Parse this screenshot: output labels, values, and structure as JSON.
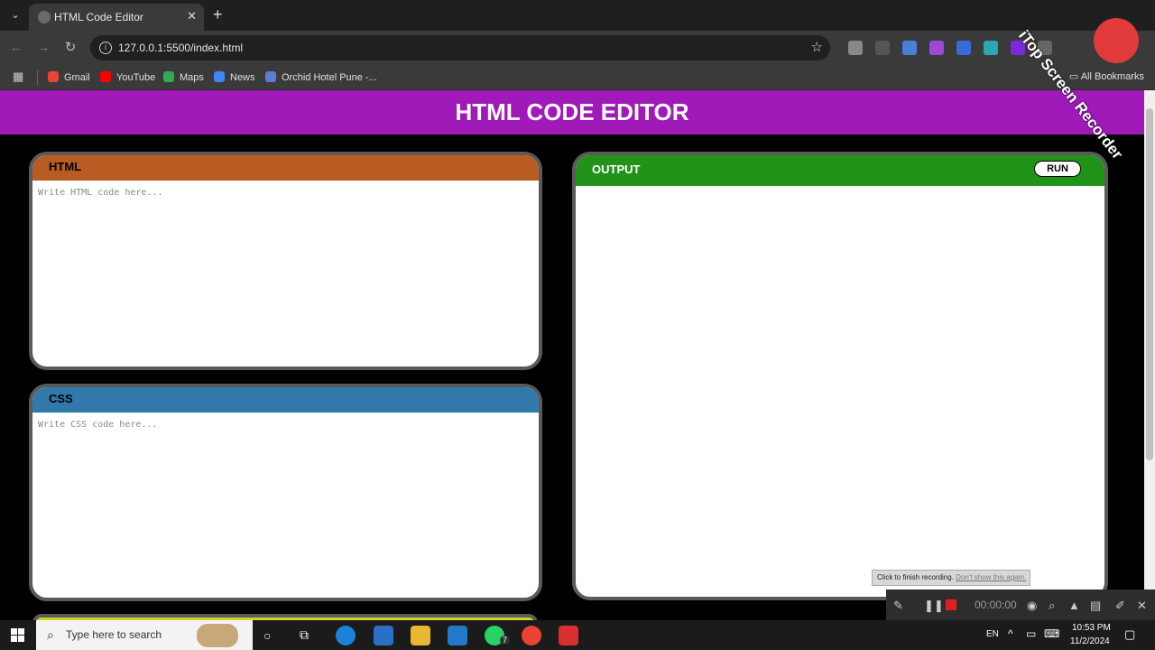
{
  "browser": {
    "tab_title": "HTML Code Editor",
    "url": "127.0.0.1:5500/index.html",
    "bookmarks": [
      "Gmail",
      "YouTube",
      "Maps",
      "News",
      "Orchid Hotel Pune -..."
    ],
    "all_bookmarks": "All Bookmarks"
  },
  "page": {
    "title": "HTML CODE EDITOR",
    "html_panel": {
      "title": "HTML",
      "placeholder": "Write HTML code here...",
      "color": "#b85c24"
    },
    "css_panel": {
      "title": "CSS",
      "placeholder": "Write CSS code here...",
      "color": "#3179aa"
    },
    "output_panel": {
      "title": "OUTPUT",
      "run_label": "RUN",
      "color": "#219318"
    },
    "header_color": "#9f1ab8"
  },
  "recorder": {
    "tip": "Click to finish recording.",
    "tip_link": "Don't show this again.",
    "time": "00:00:00",
    "watermark": "iTop Screen Recorder"
  },
  "taskbar": {
    "search_placeholder": "Type here to search",
    "language": "EN",
    "time": "10:53 PM",
    "date": "11/2/2024",
    "whatsapp_badge": "7"
  }
}
